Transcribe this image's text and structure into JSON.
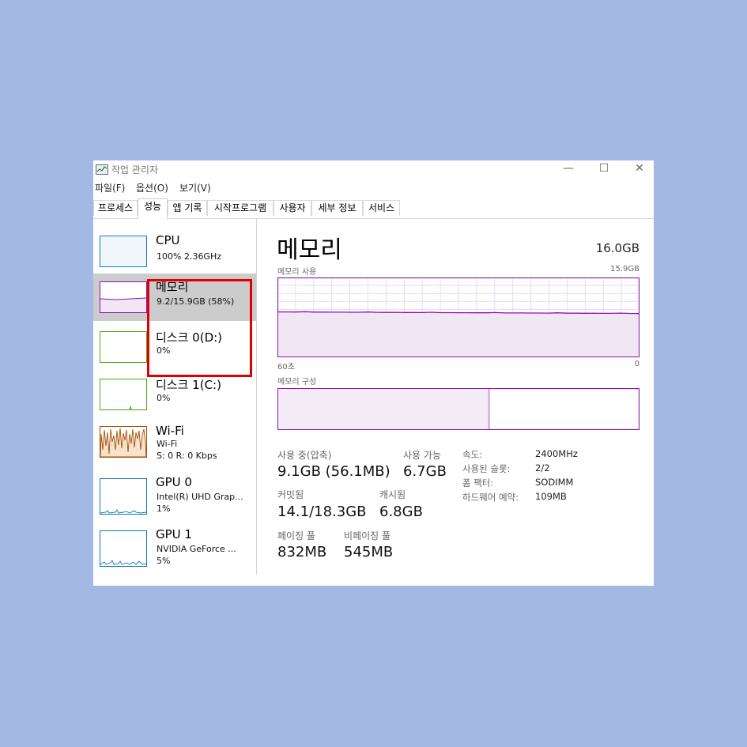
{
  "window": {
    "title": "작업 관리자",
    "controls": [
      "—",
      "☐",
      "✕"
    ]
  },
  "menu": [
    "파일(F)",
    "옵션(O)",
    "보기(V)"
  ],
  "tabs": [
    "프로세스",
    "성능",
    "앱 기록",
    "시작프로그램",
    "사용자",
    "세부 정보",
    "서비스"
  ],
  "active_tab": "성능",
  "sidebar": [
    {
      "title": "CPU",
      "sub1": "100% 2.36GHz",
      "sub2": "",
      "sub3": "",
      "color": "#1178d6"
    },
    {
      "title": "메모리",
      "sub1": "9.2/15.9GB (58%)",
      "sub2": "",
      "sub3": "",
      "color": "#8b12ae"
    },
    {
      "title": "디스크 0(D:)",
      "sub1": "0%",
      "sub2": "",
      "sub3": "",
      "color": "#4da60c"
    },
    {
      "title": "디스크 1(C:)",
      "sub1": "0%",
      "sub2": "",
      "sub3": "",
      "color": "#4da60c"
    },
    {
      "title": "Wi-Fi",
      "sub1": "Wi-Fi",
      "sub2": "S: 0 R: 0 Kbps",
      "sub3": "",
      "color": "#a74f01"
    },
    {
      "title": "GPU 0",
      "sub1": "Intel(R) UHD Grap...",
      "sub2": "1%",
      "sub3": "",
      "color": "#0d7ab4"
    },
    {
      "title": "GPU 1",
      "sub1": "NVIDIA GeForce ...",
      "sub2": "5%",
      "sub3": "",
      "color": "#0d7ab4"
    }
  ],
  "main": {
    "title": "메모리",
    "total": "16.0GB",
    "usage_label": "메모리 사용",
    "usage_max": "15.9GB",
    "axis_left": "60초",
    "axis_right": "0",
    "composition_label": "메모리 구성",
    "usage_fraction": 0.58,
    "in_use_fraction": 0.58
  },
  "stats": {
    "in_use_label": "사용 중(압축)",
    "in_use_value": "9.1GB (56.1MB)",
    "available_label": "사용 가능",
    "available_value": "6.7GB",
    "committed_label": "커밋됨",
    "committed_value": "14.1/18.3GB",
    "cached_label": "캐시됨",
    "cached_value": "6.8GB",
    "paged_label": "페이징 풀",
    "paged_value": "832MB",
    "nonpaged_label": "비페이징 풀",
    "nonpaged_value": "545MB"
  },
  "specs": {
    "speed_label": "속도:",
    "speed_value": "2400MHz",
    "slots_label": "사용된 슬롯:",
    "slots_value": "2/2",
    "form_label": "폼 팩터:",
    "form_value": "SODIMM",
    "reserved_label": "하드웨어 예약:",
    "reserved_value": "109MB"
  },
  "colors": {
    "memory": "#8b12ae",
    "highlight": "#e00000",
    "background": "#a3b8e2"
  }
}
